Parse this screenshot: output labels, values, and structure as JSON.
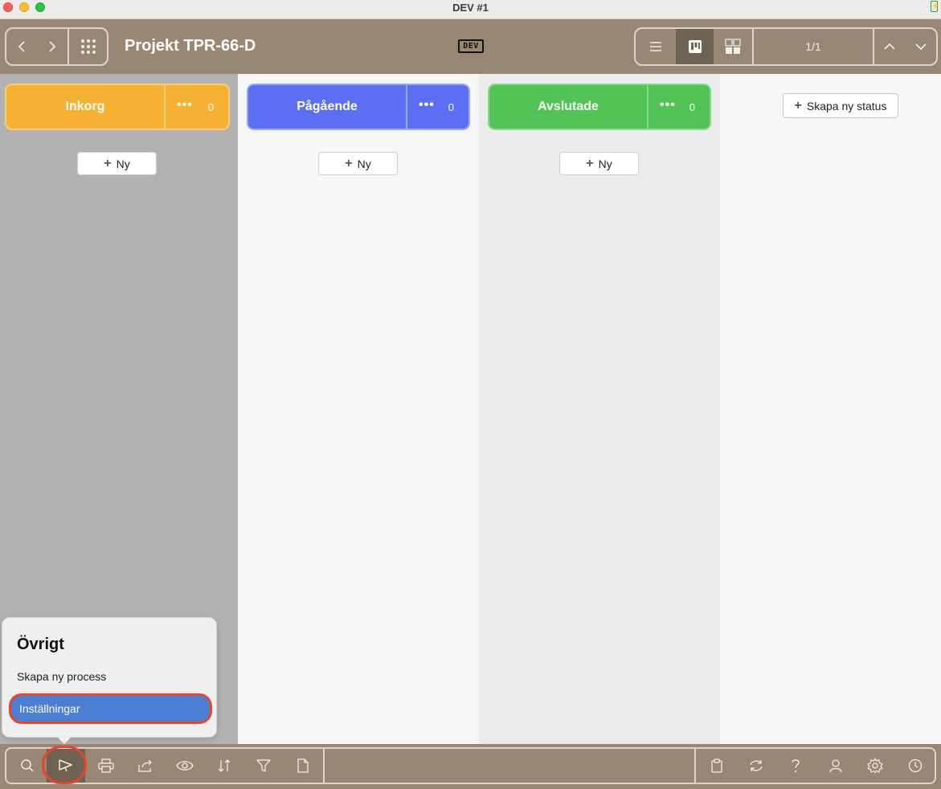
{
  "window": {
    "title": "DEV #1"
  },
  "toolbar": {
    "project_title": "Projekt TPR-66-D",
    "dev_badge": "DEV",
    "pager": "1/1",
    "icons": [
      "chevron-left-icon",
      "chevron-right-icon",
      "app-grid-icon",
      "list-view-icon",
      "board-view-icon",
      "card-grid-view-icon",
      "chevron-up-icon",
      "chevron-down-icon"
    ]
  },
  "board": {
    "columns": [
      {
        "name": "Inkorg",
        "count": "0",
        "color": "#f5b232",
        "new_label": "Ny"
      },
      {
        "name": "Pågående",
        "count": "0",
        "color": "#5c6ff2",
        "new_label": "Ny"
      },
      {
        "name": "Avslutade",
        "count": "0",
        "color": "#52c455",
        "new_label": "Ny"
      }
    ],
    "more_dots": "•••",
    "create_status_label": "Skapa ny status"
  },
  "popover": {
    "title": "Övrigt",
    "items": [
      "Skapa ny process",
      "Inställningar"
    ],
    "selected_index": 1
  },
  "bottom_toolbar": {
    "icons": [
      "search-icon",
      "megaphone-icon",
      "print-icon",
      "share-icon",
      "eye-icon",
      "sort-icon",
      "filter-icon",
      "document-icon",
      "clipboard-icon",
      "refresh-icon",
      "help-icon",
      "user-icon",
      "settings-icon",
      "history-icon"
    ]
  },
  "colors": {
    "toolbar": "#978773",
    "accent_select": "#4a7fd3",
    "highlight": "#e8442a"
  }
}
